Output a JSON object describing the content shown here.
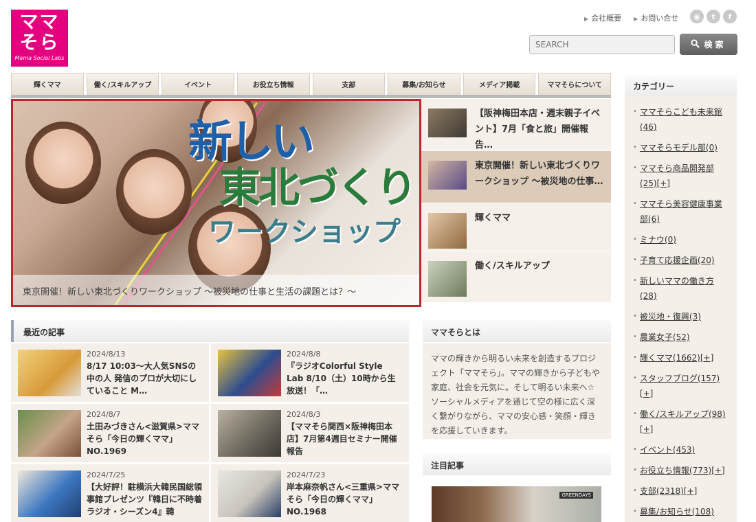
{
  "logo": {
    "line1": "ママ",
    "line2": "そら",
    "sub": "Mama Social Labs"
  },
  "header": {
    "links": [
      "会社概要",
      "お問い合せ"
    ],
    "social": [
      {
        "icon": "rss-icon",
        "glyph": "◉"
      },
      {
        "icon": "twitter-icon",
        "glyph": "t"
      },
      {
        "icon": "facebook-icon",
        "glyph": "f"
      }
    ],
    "search_placeholder": "SEARCH",
    "search_button": "検索"
  },
  "nav": [
    "輝くママ",
    "働く/スキルアップ",
    "イベント",
    "お役立ち情報",
    "支部",
    "募集/お知らせ",
    "メディア掲載",
    "ママそらについて"
  ],
  "hero": {
    "title1": "新しい",
    "title2": "東北づくり",
    "title3": "ワークショップ",
    "caption": "東京開催！新しい東北づくりワークショップ 〜被災地の仕事と生活の課題とは？〜"
  },
  "slider_list": [
    {
      "text": "【阪神梅田本店・週末親子イベント】7月「食と旅」開催報告…",
      "active": false
    },
    {
      "text": "東京開催！新しい東北づくりワークショップ 〜被災地の仕事…",
      "active": true
    },
    {
      "text": "輝くママ",
      "active": false
    },
    {
      "text": "働く/スキルアップ",
      "active": false
    }
  ],
  "recent": {
    "heading": "最近の記事",
    "items": [
      {
        "date": "2024/8/13",
        "title": "8/17 10:03〜大人気SNSの中の人 発信のプロが大切にしていること M…",
        "color": "#d89a3a"
      },
      {
        "date": "2024/8/8",
        "title": "『ラジオColorful Style Lab 8/10（土）10時から生放送！「…",
        "color": "#2e4d8f"
      },
      {
        "date": "2024/8/7",
        "title": "土田みづきさん<滋賀県>ママそら「今日の輝くママ」NO.1969",
        "color": "#c4a488"
      },
      {
        "date": "2024/8/3",
        "title": "【ママそら関西×阪神梅田本店】7月第4週目セミナー開催報告",
        "color": "#6f6a5e"
      },
      {
        "date": "2024/7/25",
        "title": "【大好評！駐横浜大韓民国総領事館プレゼンツ『韓日に不時着ラジオ・シーズン4』韓",
        "color": "#3d78c2"
      },
      {
        "date": "2024/7/23",
        "title": "岸本麻奈帆さん<三重県>ママそら「今日の輝くママ」NO.1968",
        "color": "#c9c4bd"
      }
    ]
  },
  "about": {
    "heading": "ママそらとは",
    "text": "ママの輝きから明るい未来を創造するプロジェクト「ママそら」。ママの輝きから子どもや家庭、社会を元気に。そして明るい未来へ☆ソーシャルメディアを通じて空の様に広く深く繋がりながら、ママの安心感・笑顔・輝きを応援していきます。"
  },
  "featured": {
    "heading": "注目記事",
    "sign": "GREENDAYS"
  },
  "category": {
    "heading": "カテゴリー",
    "items": [
      {
        "label": "ママそらこども未来館",
        "count": "(46)",
        "plus": ""
      },
      {
        "label": "ママそらモデル部",
        "count": "(0)",
        "plus": ""
      },
      {
        "label": "ママそら商品開発部",
        "count": "(25)",
        "plus": "[+]"
      },
      {
        "label": "ママそら美容健康事業部",
        "count": "(6)",
        "plus": ""
      },
      {
        "label": "ミナウ",
        "count": "(0)",
        "plus": ""
      },
      {
        "label": "子育て応援企画",
        "count": "(20)",
        "plus": ""
      },
      {
        "label": "新しいママの働き方",
        "count": "(28)",
        "plus": ""
      },
      {
        "label": "被災地・復興",
        "count": "(3)",
        "plus": ""
      },
      {
        "label": "農業女子",
        "count": "(52)",
        "plus": ""
      },
      {
        "label": "輝くママ",
        "count": "(1662)",
        "plus": "[+]"
      },
      {
        "label": "スタッフブログ",
        "count": "(157)",
        "plus": "[+]"
      },
      {
        "label": "働く/スキルアップ",
        "count": "(98)",
        "plus": "[+]"
      },
      {
        "label": "イベント",
        "count": "(453)",
        "plus": ""
      },
      {
        "label": "お役立ち情報",
        "count": "(773)",
        "plus": "[+]"
      },
      {
        "label": "支部",
        "count": "(2318)",
        "plus": "[+]"
      },
      {
        "label": "募集/お知らせ",
        "count": "(108)",
        "plus": ""
      }
    ]
  }
}
